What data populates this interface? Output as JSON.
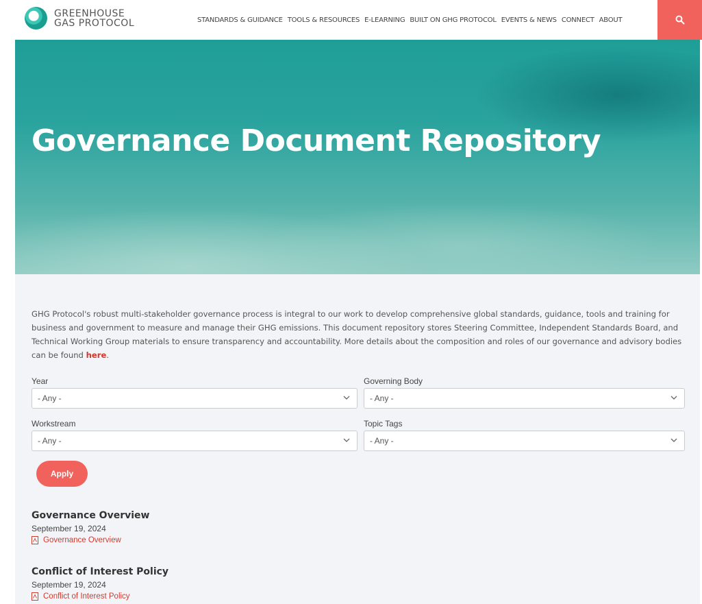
{
  "header": {
    "logo_line1": "GREENHOUSE",
    "logo_line2": "GAS PROTOCOL",
    "nav": [
      "STANDARDS & GUIDANCE",
      "TOOLS & RESOURCES",
      "E-LEARNING",
      "BUILT ON GHG PROTOCOL",
      "EVENTS & NEWS",
      "CONNECT",
      "ABOUT"
    ],
    "search_icon": "search-icon",
    "accent_color": "#f2625c"
  },
  "hero": {
    "title": "Governance Document Repository"
  },
  "intro": {
    "text": "GHG Protocol's robust multi-stakeholder governance process is integral to our work to develop comprehensive global standards, guidance, tools and training for business and government to measure and manage their GHG emissions. This document repository stores Steering Committee, Independent Standards Board, and Technical Working Group materials to ensure transparency and accountability. More details about the composition and roles of our governance and advisory bodies can be found ",
    "link_text": "here",
    "trailing": "."
  },
  "filters": {
    "year": {
      "label": "Year",
      "value": "- Any -"
    },
    "governing_body": {
      "label": "Governing Body",
      "value": "- Any -"
    },
    "workstream": {
      "label": "Workstream",
      "value": "- Any -"
    },
    "topic_tags": {
      "label": "Topic Tags",
      "value": "- Any -"
    },
    "apply_label": "Apply"
  },
  "documents": [
    {
      "title": "Governance Overview",
      "date": "September 19, 2024",
      "link": "Governance Overview"
    },
    {
      "title": "Conflict of Interest Policy",
      "date": "September 19, 2024",
      "link": "Conflict of Interest Policy"
    }
  ]
}
